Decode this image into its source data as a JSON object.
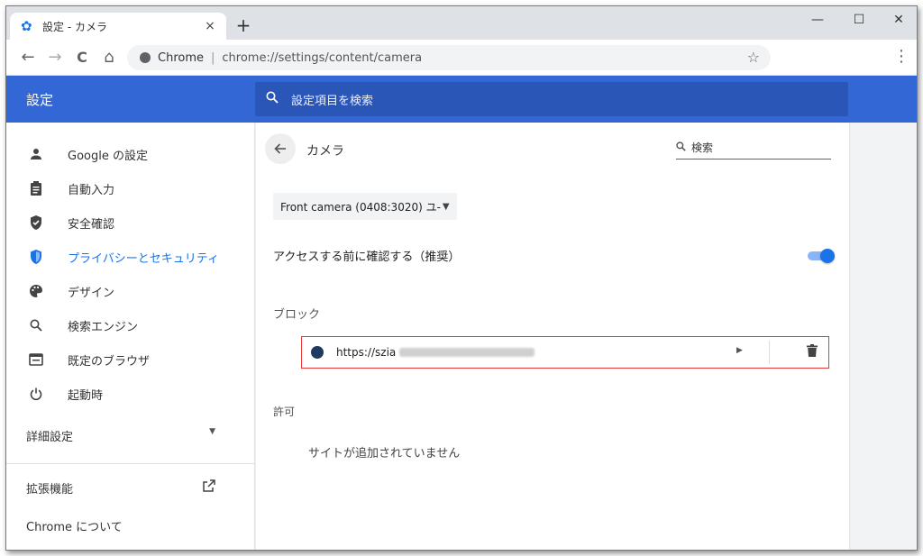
{
  "window": {
    "tab_title": "設定 - カメラ",
    "tab_close": "×",
    "new_tab": "+",
    "minimize": "—",
    "maximize": "☐",
    "close": "✕"
  },
  "toolbar": {
    "back": "←",
    "forward": "→",
    "reload": "C",
    "home": "⌂",
    "chrome_label": "Chrome",
    "separator": "|",
    "url": "chrome://settings/content/camera",
    "star": "☆",
    "menu": "⋮"
  },
  "header": {
    "title": "設定",
    "search_placeholder": "設定項目を検索"
  },
  "sidebar": {
    "items": [
      {
        "label": "Google の設定",
        "icon": "person-icon"
      },
      {
        "label": "自動入力",
        "icon": "clipboard-icon"
      },
      {
        "label": "安全確認",
        "icon": "shield-check-icon"
      },
      {
        "label": "プライバシーとセキュリティ",
        "icon": "shield-icon"
      },
      {
        "label": "デザイン",
        "icon": "palette-icon"
      },
      {
        "label": "検索エンジン",
        "icon": "search-icon"
      },
      {
        "label": "既定のブラウザ",
        "icon": "browser-icon"
      },
      {
        "label": "起動時",
        "icon": "power-icon"
      }
    ],
    "advanced": "詳細設定",
    "extensions": "拡張機能",
    "about": "Chrome について"
  },
  "main": {
    "title": "カメラ",
    "search_placeholder": "検索",
    "camera_select": "Front camera (0408:3020) ユ-",
    "ask_label": "アクセスする前に確認する（推奨）",
    "ask_enabled": true,
    "block_label": "ブロック",
    "blocked_sites": [
      {
        "url": "https://szia"
      }
    ],
    "allow_label": "許可",
    "allow_empty": "サイトが追加されていません"
  },
  "colors": {
    "accent": "#1a73e8",
    "header": "#3367d6",
    "highlight_border": "#e53935"
  }
}
